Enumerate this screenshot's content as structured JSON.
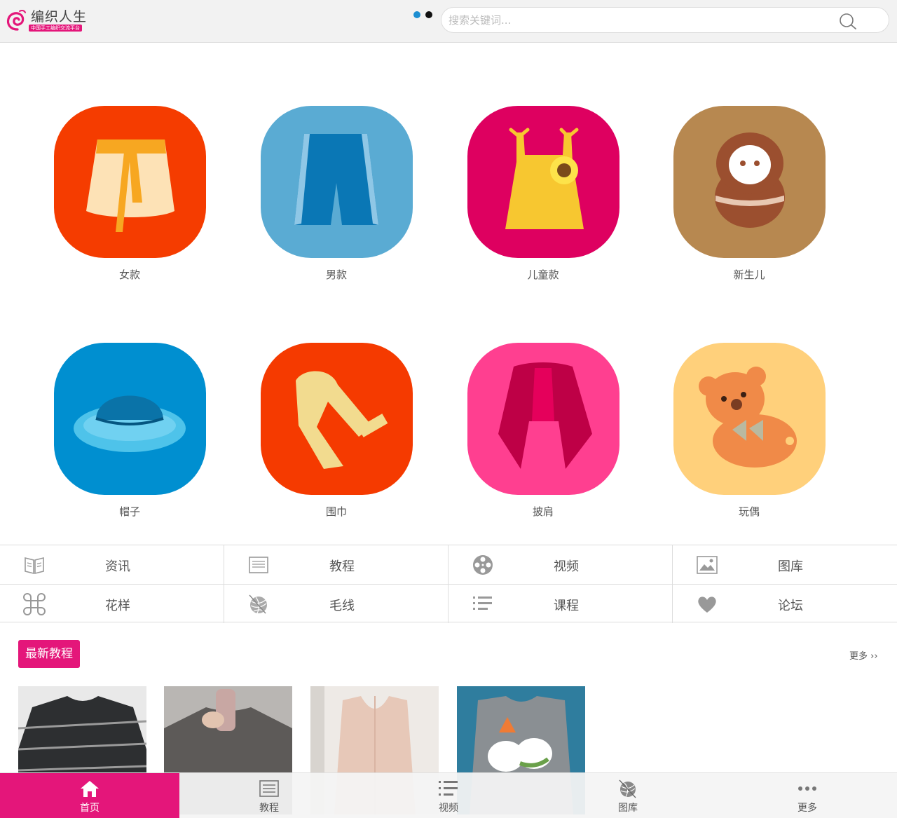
{
  "header": {
    "logo_title": "编织人生",
    "logo_tagline": "中国手工编织交流平台",
    "search_placeholder": "搜索关键词..."
  },
  "categories": [
    {
      "label": "女款",
      "bg": "#f53c00",
      "icon": "skirt-icon"
    },
    {
      "label": "男款",
      "bg": "#5aabd3",
      "icon": "shorts-icon"
    },
    {
      "label": "儿童款",
      "bg": "#de0060",
      "icon": "child-top-icon"
    },
    {
      "label": "新生儿",
      "bg": "#b78850",
      "icon": "newborn-doll-icon"
    },
    {
      "label": "帽子",
      "bg": "#008fd0",
      "icon": "hat-icon"
    },
    {
      "label": "围巾",
      "bg": "#f53a00",
      "icon": "scarf-icon"
    },
    {
      "label": "披肩",
      "bg": "#ff3f90",
      "icon": "shawl-icon"
    },
    {
      "label": "玩偶",
      "bg": "#ffd07b",
      "icon": "teddy-bear-icon"
    }
  ],
  "menu": [
    {
      "label": "资讯",
      "icon": "news-icon"
    },
    {
      "label": "教程",
      "icon": "tutorial-icon"
    },
    {
      "label": "视频",
      "icon": "film-reel-icon"
    },
    {
      "label": "图库",
      "icon": "image-icon"
    },
    {
      "label": "花样",
      "icon": "command-knot-icon"
    },
    {
      "label": "毛线",
      "icon": "yarn-ball-icon"
    },
    {
      "label": "课程",
      "icon": "list-icon"
    },
    {
      "label": "论坛",
      "icon": "heart-icon"
    }
  ],
  "latest": {
    "title": "最新教程",
    "more": "更多 ››"
  },
  "bottom_nav": [
    {
      "label": "首页",
      "icon": "home-icon",
      "active": true
    },
    {
      "label": "教程",
      "icon": "tutorial-icon",
      "active": false
    },
    {
      "label": "视频",
      "icon": "list-icon",
      "active": false
    },
    {
      "label": "图库",
      "icon": "yarn-ball-icon",
      "active": false
    },
    {
      "label": "更多",
      "icon": "more-dots-icon",
      "active": false
    }
  ],
  "colors": {
    "brand": "#e4167a",
    "active_dot": "#1d8ed1"
  }
}
